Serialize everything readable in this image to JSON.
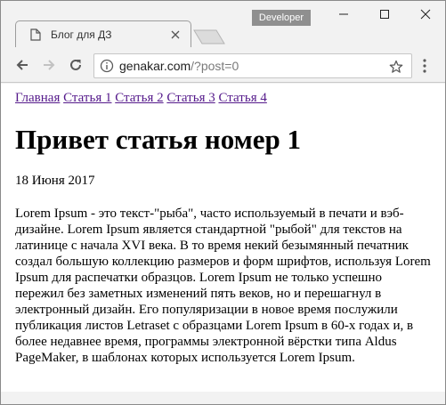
{
  "window": {
    "tab_title": "Блог для ДЗ",
    "developer_badge": "Developer"
  },
  "toolbar": {
    "url_host": "genakar.com",
    "url_path": "/?post=0"
  },
  "page": {
    "nav": [
      "Главная",
      "Статья 1",
      "Статья 2",
      "Статья 3",
      "Статья 4"
    ],
    "title": "Привет статья номер 1",
    "date": "18 Июня 2017",
    "body": "Lorem Ipsum - это текст-\"рыба\", часто используемый в печати и вэб-дизайне. Lorem Ipsum является стандартной \"рыбой\" для текстов на латинице с начала XVI века. В то время некий безымянный печатник создал большую коллекцию размеров и форм шрифтов, используя Lorem Ipsum для распечатки образцов. Lorem Ipsum не только успешно пережил без заметных изменений пять веков, но и перешагнул в электронный дизайн. Его популяризации в новое время послужили публикация листов Letraset с образцами Lorem Ipsum в 60-х годах и, в более недавнее время, программы электронной вёрстки типа Aldus PageMaker, в шаблонах которых используется Lorem Ipsum."
  },
  "icons": {
    "tab": "page-icon",
    "back": "back-arrow-icon",
    "forward": "forward-arrow-icon",
    "reload": "reload-icon",
    "info": "info-icon",
    "bookmark": "star-icon",
    "menu": "kebab-menu-icon"
  },
  "colors": {
    "link": "#551a8b",
    "chrome": "#f2f2f2",
    "badge": "#8f8f8f"
  }
}
